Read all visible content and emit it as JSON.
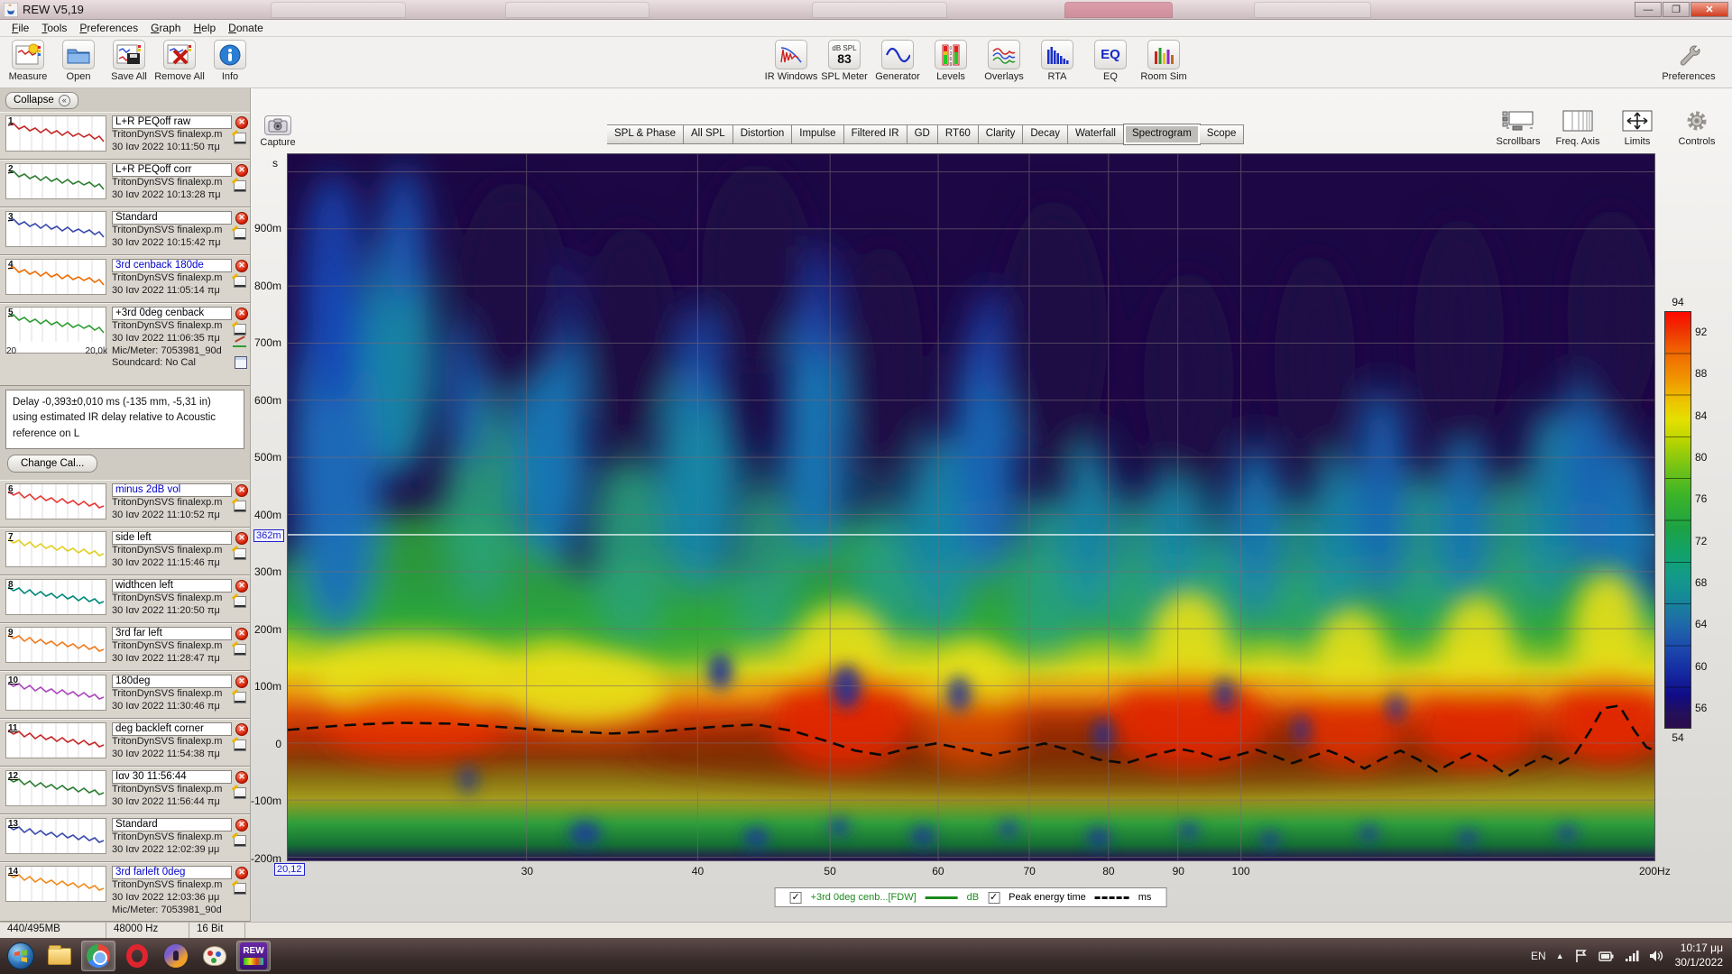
{
  "window": {
    "title": "REW V5,19",
    "buttons": {
      "minimize": "—",
      "restore": "❐",
      "close": "✕"
    }
  },
  "menu": {
    "items": [
      "File",
      "Tools",
      "Preferences",
      "Graph",
      "Help",
      "Donate"
    ]
  },
  "toolbar": {
    "left": [
      {
        "label": "Measure"
      },
      {
        "label": "Open"
      },
      {
        "label": "Save All"
      },
      {
        "label": "Remove All"
      },
      {
        "label": "Info"
      }
    ],
    "center": [
      {
        "label": "IR Windows"
      },
      {
        "label": "SPL Meter",
        "badge_top": "dB SPL",
        "badge": "83"
      },
      {
        "label": "Generator"
      },
      {
        "label": "Levels"
      },
      {
        "label": "Overlays"
      },
      {
        "label": "RTA"
      },
      {
        "label": "EQ",
        "icon_text": "EQ"
      },
      {
        "label": "Room Sim"
      }
    ],
    "right": [
      {
        "label": "Preferences"
      }
    ]
  },
  "graph_toolbar": {
    "capture_label": "Capture",
    "tabs": [
      {
        "label": "SPL & Phase"
      },
      {
        "label": "All SPL"
      },
      {
        "label": "Distortion"
      },
      {
        "label": "Impulse"
      },
      {
        "label": "Filtered IR"
      },
      {
        "label": "GD"
      },
      {
        "label": "RT60"
      },
      {
        "label": "Clarity"
      },
      {
        "label": "Decay"
      },
      {
        "label": "Waterfall"
      },
      {
        "label": "Spectrogram",
        "active": true
      },
      {
        "label": "Scope"
      }
    ],
    "right_buttons": [
      {
        "label": "Scrollbars"
      },
      {
        "label": "Freq. Axis"
      },
      {
        "label": "Limits"
      },
      {
        "label": "Controls"
      }
    ]
  },
  "sidebar": {
    "collapse_label": "Collapse",
    "measurements_a": [
      {
        "num": "1",
        "name": "L+R PEQoff raw",
        "file": "TritonDynSVS finalexp.m",
        "date": "30 Ιαν 2022 10:11:50 πμ",
        "color": "#c62828"
      },
      {
        "num": "2",
        "name": "L+R PEQoff corr",
        "file": "TritonDynSVS finalexp.m",
        "date": "30 Ιαν 2022 10:13:28 πμ",
        "color": "#2e7d32"
      },
      {
        "num": "3",
        "name": "Standard",
        "file": "TritonDynSVS finalexp.m",
        "date": "30 Ιαν 2022 10:15:42 πμ",
        "color": "#3949ab"
      },
      {
        "num": "4",
        "name": "3rd cenback 180de",
        "file": "TritonDynSVS finalexp.m",
        "date": "30 Ιαν 2022 11:05:14 πμ",
        "color": "#ef6c00",
        "name_color": "blue"
      },
      {
        "num": "5",
        "name": "+3rd 0deg cenback",
        "file": "TritonDynSVS finalexp.m",
        "date": "30 Ιαν 2022 11:06:35 πμ",
        "color": "#2e9e33",
        "mic": "Mic/Meter: 7053981_90d",
        "soundcard": "Soundcard: No Cal",
        "axis_left": "20",
        "axis_right": "20,0k"
      }
    ],
    "delay_note": "Delay -0,393±0,010 ms (-135 mm, -5,31 in) using estimated IR delay relative to Acoustic reference on  L",
    "change_cal_label": "Change Cal...",
    "measurements_b": [
      {
        "num": "6",
        "name": "minus 2dB vol",
        "file": "TritonDynSVS finalexp.m",
        "date": "30 Ιαν 2022 11:10:52 πμ",
        "color": "#e53935",
        "name_color": "blue"
      },
      {
        "num": "7",
        "name": "side left",
        "file": "TritonDynSVS finalexp.m",
        "date": "30 Ιαν 2022 11:15:46 πμ",
        "color": "#e0d021"
      },
      {
        "num": "8",
        "name": "widthcen left",
        "file": "TritonDynSVS finalexp.m",
        "date": "30 Ιαν 2022 11:20:50 πμ",
        "color": "#00897b"
      },
      {
        "num": "9",
        "name": "3rd far left",
        "file": "TritonDynSVS finalexp.m",
        "date": "30 Ιαν 2022 11:28:47 πμ",
        "color": "#ef7b1d"
      },
      {
        "num": "10",
        "name": "180deg",
        "file": "TritonDynSVS finalexp.m",
        "date": "30 Ιαν 2022 11:30:46 πμ",
        "color": "#ab47bc"
      },
      {
        "num": "11",
        "name": "deg backleft corner",
        "file": "TritonDynSVS finalexp.m",
        "date": "30 Ιαν 2022 11:54:38 πμ",
        "color": "#c62828"
      },
      {
        "num": "12",
        "name": "Ιαν 30 11:56:44",
        "file": "TritonDynSVS finalexp.m",
        "date": "30 Ιαν 2022 11:56:44 πμ",
        "color": "#2e7d32"
      },
      {
        "num": "13",
        "name": "Standard",
        "file": "TritonDynSVS finalexp.m",
        "date": "30 Ιαν 2022 12:02:39 μμ",
        "color": "#3949ab"
      },
      {
        "num": "14",
        "name": "3rd farleft 0deg",
        "file": "TritonDynSVS finalexp.m",
        "date": "30 Ιαν 2022 12:03:36 μμ",
        "color": "#ef8c1d",
        "name_color": "blue",
        "mic": "Mic/Meter: 7053981_90d",
        "last": true
      }
    ]
  },
  "spectrogram": {
    "y_unit": "s",
    "y_ticks": [
      "900m",
      "800m",
      "700m",
      "600m",
      "500m",
      "400m",
      "300m",
      "200m",
      "100m",
      "0",
      "-100m",
      "-200m"
    ],
    "cursor_y": "362m",
    "cursor_x": "20,12",
    "x_ticks": [
      "30",
      "40",
      "50",
      "60",
      "70",
      "80",
      "90",
      "100"
    ],
    "x_end": "200Hz",
    "colorbar": {
      "top": "94",
      "bottom": "54",
      "ticks": [
        "92",
        "88",
        "84",
        "80",
        "76",
        "72",
        "68",
        "64",
        "60",
        "56"
      ]
    },
    "legend": {
      "trace_label": "+3rd 0deg cenb...[FDW]",
      "trace_unit": "dB",
      "peak_label": "Peak energy time",
      "peak_unit": "ms"
    }
  },
  "chart_data": {
    "type": "heatmap",
    "subtype": "wavelet-spectrogram",
    "x_axis": {
      "label": "Hz",
      "scale": "log",
      "min": 20,
      "max": 200,
      "ticks": [
        30,
        40,
        50,
        60,
        70,
        80,
        90,
        100,
        200
      ]
    },
    "y_axis": {
      "label": "s",
      "min": -0.2,
      "max": 1.0,
      "ticks": [
        0.9,
        0.8,
        0.7,
        0.6,
        0.5,
        0.4,
        0.3,
        0.2,
        0.1,
        0.0,
        -0.1,
        -0.2
      ]
    },
    "color_axis": {
      "unit": "dB",
      "min": 54,
      "max": 94,
      "ticks": [
        56,
        60,
        64,
        68,
        72,
        76,
        80,
        84,
        88,
        92
      ]
    },
    "series": [
      {
        "name": "+3rd 0deg cenb...[FDW]",
        "unit": "dB",
        "style": "solid",
        "color": "#1c8a1c"
      },
      {
        "name": "Peak energy time",
        "unit": "ms",
        "style": "dashed",
        "color": "#000000"
      }
    ],
    "cursor": {
      "freq_hz": 20.12,
      "time_s": 0.362
    },
    "summary": "High-SPL ridge (86-94 dB, red/orange) near t = 0-100 ms across 20-200 Hz with strongest energy near 48-53, 85-100, 115-125, 140-155 and 170-200 Hz; vertical decay plumes (green to blue) extend to 300-900 ms, tallest below 70 Hz; background floor ~54-58 dB (dark purple); peak-energy-time trace undulates around t = 0-60 ms, rising sharply near 190 Hz."
  },
  "statusbar": {
    "cells": [
      "440/495MB",
      "48000 Hz",
      "16 Bit"
    ]
  },
  "taskbar": {
    "items": [
      {
        "icon": "start"
      },
      {
        "icon": "file-explorer"
      },
      {
        "icon": "chrome",
        "active": true
      },
      {
        "icon": "opera"
      },
      {
        "icon": "firefox"
      },
      {
        "icon": "paint"
      },
      {
        "icon": "rew",
        "active": true,
        "label": "REW"
      }
    ],
    "tray": {
      "lang": "EN",
      "time": "10:17 μμ",
      "date": "30/1/2022"
    }
  }
}
